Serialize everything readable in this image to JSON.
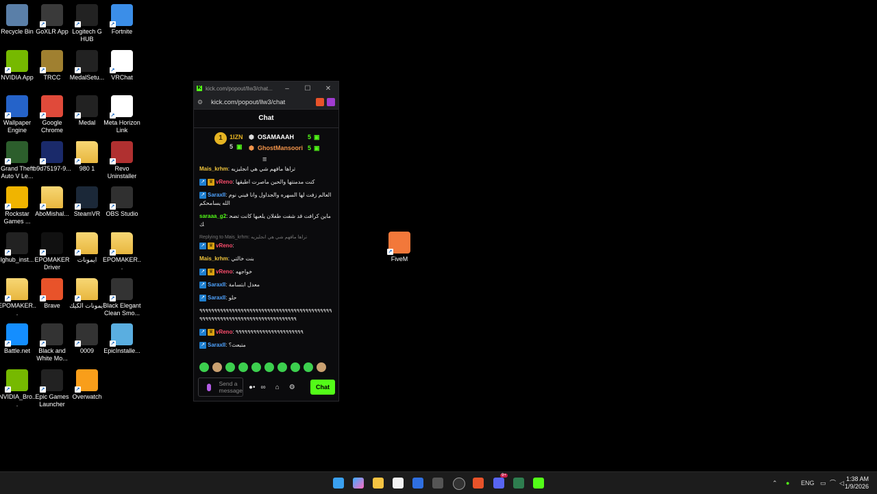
{
  "desktop": {
    "icons": [
      {
        "label": "Recycle Bin",
        "icon": "recycle-bin-icon",
        "color": "#5a7fa8"
      },
      {
        "label": "GoXLR App",
        "icon": "goxlr-icon",
        "color": "#3a3a3a"
      },
      {
        "label": "Logitech G HUB",
        "icon": "logitech-icon",
        "color": "#222"
      },
      {
        "label": "Fortnite",
        "icon": "fortnite-icon",
        "color": "#3b8ee8"
      },
      {
        "label": "NVIDIA App",
        "icon": "nvidia-icon",
        "color": "#76b900"
      },
      {
        "label": "TRCC",
        "icon": "trcc-icon",
        "color": "#a08030"
      },
      {
        "label": "MedalSetu...",
        "icon": "medal-icon",
        "color": "#222"
      },
      {
        "label": "VRChat",
        "icon": "vrchat-icon",
        "color": "#ffffff"
      },
      {
        "label": "Wallpaper Engine",
        "icon": "wallpaper-engine-icon",
        "color": "#2563c9"
      },
      {
        "label": "Google Chrome",
        "icon": "chrome-icon",
        "color": "#e04a3a"
      },
      {
        "label": "Medal",
        "icon": "medal-icon",
        "color": "#222"
      },
      {
        "label": "Meta Horizon Link",
        "icon": "meta-icon",
        "color": "#ffffff"
      },
      {
        "label": "Grand Theft Auto V Le...",
        "icon": "gta-icon",
        "color": "#2c5e2c"
      },
      {
        "label": "b9d75197-9...",
        "icon": "file-icon",
        "color": "#1a2a6a"
      },
      {
        "label": "980 1",
        "icon": "folder-icon",
        "color": "folder"
      },
      {
        "label": "Revo Uninstaller",
        "icon": "revo-icon",
        "color": "#b03030"
      },
      {
        "label": "Rockstar Games ...",
        "icon": "rockstar-icon",
        "color": "#f0b400"
      },
      {
        "label": "AboMishal...",
        "icon": "folder-icon",
        "color": "folder"
      },
      {
        "label": "SteamVR",
        "icon": "steamvr-icon",
        "color": "#1b2838"
      },
      {
        "label": "OBS Studio",
        "icon": "obs-icon",
        "color": "#303030"
      },
      {
        "label": "lghub_inst...",
        "icon": "logitech-icon",
        "color": "#222"
      },
      {
        "label": "EPOMAKER Driver",
        "icon": "epomaker-icon",
        "color": "#111"
      },
      {
        "label": "ايمونات",
        "icon": "folder-icon",
        "color": "folder"
      },
      {
        "label": "EPOMAKER...",
        "icon": "folder-icon",
        "color": "folder"
      },
      {
        "label": "EPOMAKER...",
        "icon": "folder-icon",
        "color": "folder"
      },
      {
        "label": "Brave",
        "icon": "brave-icon",
        "color": "#e8532a"
      },
      {
        "label": "ايمونات الكيك",
        "icon": "folder-icon",
        "color": "folder"
      },
      {
        "label": "Black Elegant Clean Smo...",
        "icon": "video-icon",
        "color": "#333"
      },
      {
        "label": "Battle.net",
        "icon": "battlenet-icon",
        "color": "#148eff"
      },
      {
        "label": "Black and White Mo...",
        "icon": "video-icon",
        "color": "#333"
      },
      {
        "label": "0009",
        "icon": "video-icon",
        "color": "#333"
      },
      {
        "label": "EpicInstalle...",
        "icon": "epic-installer-icon",
        "color": "#5aaee0"
      },
      {
        "label": "NVIDIA_Bro...",
        "icon": "nvidia-icon",
        "color": "#76b900"
      },
      {
        "label": "Epic Games Launcher",
        "icon": "epic-icon",
        "color": "#222"
      },
      {
        "label": "Overwatch",
        "icon": "overwatch-icon",
        "color": "#f99e1a"
      }
    ],
    "fivem": {
      "label": "FiveM",
      "icon": "fivem-icon",
      "color": "#f2783a"
    }
  },
  "window": {
    "title": "kick.com/popout/llw3/chat...",
    "url": "kick.com/popout/llw3/chat",
    "chat_header": "Chat",
    "leaderboard": {
      "rank": "1",
      "top_name": "1IZN",
      "top_count": "5",
      "first": {
        "name": "OSAMAAAH",
        "count": "5"
      },
      "second": {
        "name": "GhostMansoori",
        "count": "5"
      }
    },
    "messages": [
      {
        "user": "Mais_krhm",
        "color": "#f0c53c",
        "badges": [],
        "text": "تراها مافهم شي هي انجليزيه"
      },
      {
        "user": "vReno",
        "color": "#ff4d6d",
        "badges": [
          "blue",
          "gold"
        ],
        "text": "كنت مدمنتها والحين ماصرت اطيقها"
      },
      {
        "user": "SaraxII",
        "color": "#4fa3ff",
        "badges": [
          "blue"
        ],
        "text": "العالم زفت لها السهره والجداول وانا فيني نوم الله يسامحكم"
      },
      {
        "user": "saraaa_g2",
        "color": "#53fc18",
        "badges": [],
        "text": "ماين كرافت قد شفت طفلان يلعبها كانت تضحك"
      },
      {
        "reply": "Replying to Mais_krhm: تراها مافهم شي هي انجليزيه",
        "user": "vReno",
        "color": "#ff4d6d",
        "badges": [
          "blue",
          "gold"
        ],
        "text": ""
      },
      {
        "user": "Mais_krhm",
        "color": "#f0c53c",
        "badges": [],
        "text": "بنت خالتي"
      },
      {
        "user": "vReno",
        "color": "#ff4d6d",
        "badges": [
          "blue",
          "gold"
        ],
        "text": "خواجهه"
      },
      {
        "user": "SaraxII",
        "color": "#4fa3ff",
        "badges": [
          "blue"
        ],
        "text": "معدل ابتسامة"
      },
      {
        "user": "SaraxII",
        "color": "#4fa3ff",
        "badges": [
          "blue"
        ],
        "text": "حلو"
      },
      {
        "user": "",
        "color": "#e8e8e8",
        "badges": [],
        "text": "٩٩٩٩٩٩٩٩٩٩٩٩٩٩٩٩٩٩٩٩٩٩٩٩٩٩٩٩٩٩٩٩٩٩٩٩٩٩٩٩٩٩٩٩٩٩٩٩٩٩٩٩٩٩٩٩٩٩٩٩٩٩٩٩٩٩٩٩٩٩٩٩٩٩٩٩٩٩"
      },
      {
        "user": "vReno",
        "color": "#ff4d6d",
        "badges": [
          "blue",
          "gold"
        ],
        "text": "٩٩٩٩٩٩٩٩٩٩٩٩٩٩٩٩٩٩٩٩٩٩٩"
      },
      {
        "user": "SaraxII",
        "color": "#4fa3ff",
        "badges": [
          "blue"
        ],
        "text": "متبعث؟"
      }
    ],
    "input": {
      "placeholder": "Send a message",
      "chat_button": "Chat"
    }
  },
  "taskbar": {
    "language": "ENG",
    "time": "1:38 AM",
    "date": "1/9/2026",
    "discord_badge": "9+"
  }
}
